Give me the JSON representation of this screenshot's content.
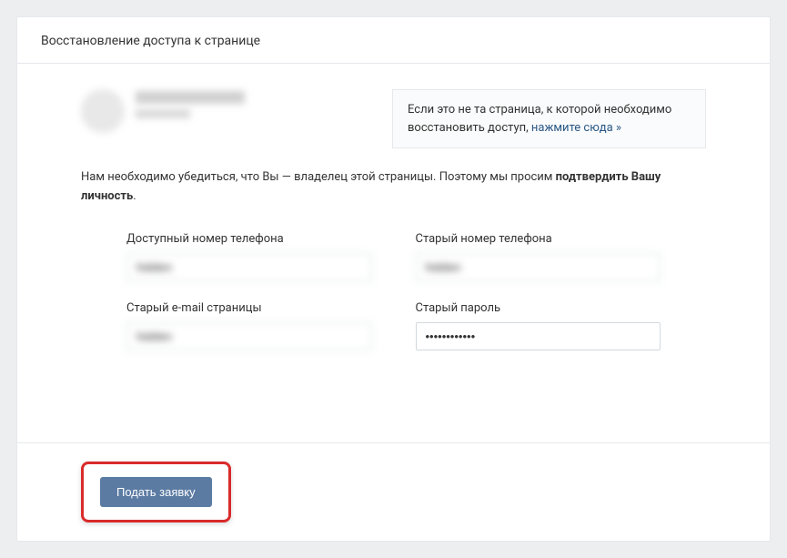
{
  "header": {
    "title": "Восстановление доступа к странице"
  },
  "notice": {
    "text_before": "Если это не та страница, к которой необходимо восстановить доступ, ",
    "link_text": "нажмите сюда »"
  },
  "verify": {
    "text_before": "Нам необходимо убедиться, что Вы — владелец этой страницы. Поэтому мы просим ",
    "bold_text": "подтвердить Вашу личность",
    "text_after": "."
  },
  "form": {
    "available_phone": {
      "label": "Доступный номер телефона",
      "value": "hidden"
    },
    "old_phone": {
      "label": "Старый номер телефона",
      "value": "hidden"
    },
    "old_email": {
      "label": "Старый e-mail страницы",
      "value": "hidden"
    },
    "old_password": {
      "label": "Старый пароль",
      "value": "••••••••••••"
    }
  },
  "footer": {
    "submit_label": "Подать заявку"
  }
}
